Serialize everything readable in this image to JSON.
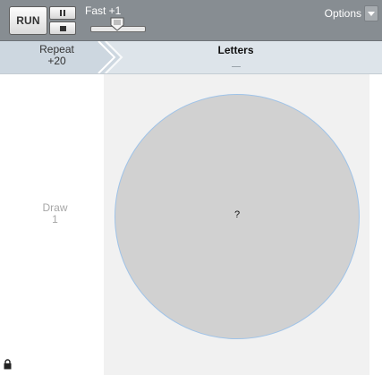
{
  "toolbar": {
    "run_label": "RUN",
    "speed_label": "Fast +1",
    "speed_level": 0.5,
    "options_label": "Options"
  },
  "header": {
    "repeat_label": "Repeat",
    "repeat_value": "+20",
    "letters_title": "Letters"
  },
  "body": {
    "draw_label": "Draw",
    "draw_value": "1",
    "circle_text": "?"
  },
  "colors": {
    "toolbar_bg": "#878d92",
    "header_bg": "#dde4ea",
    "repeat_tab_bg": "#cdd7e0",
    "canvas_bg": "#f1f1f1",
    "circle_fill": "#d1d1d1",
    "circle_outline": "#9fc3e8"
  },
  "icons": {
    "pause": "pause-icon",
    "stop": "stop-icon",
    "slider_thumb": "slider-thumb-icon",
    "dropdown": "chevron-down-icon",
    "lock": "lock-icon"
  }
}
